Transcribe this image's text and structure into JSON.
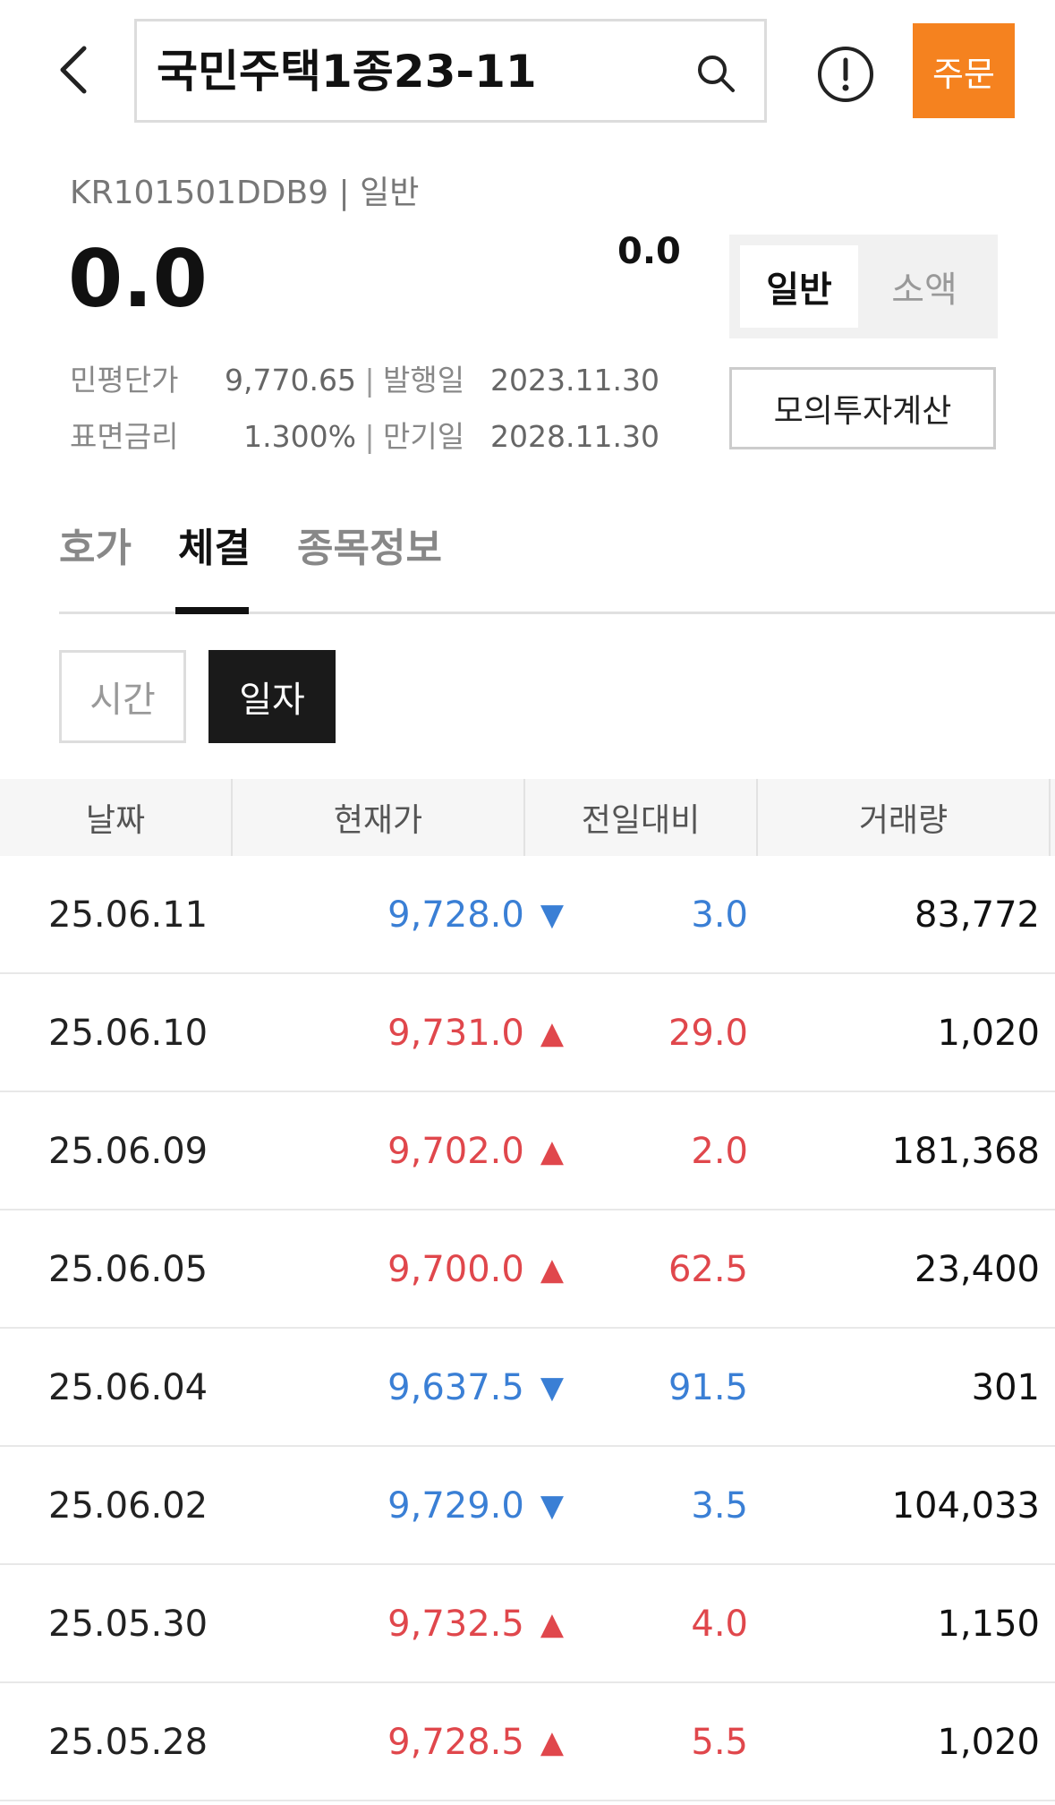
{
  "header": {
    "search_text": "국민주택1종23-11",
    "order_label": "주문"
  },
  "summary": {
    "code_line": "KR101501DDB9 | 일반",
    "price": "0.0",
    "change": "0.0",
    "segment": {
      "active": "일반",
      "inactive": "소액"
    },
    "calc_label": "모의투자계산",
    "info": [
      {
        "label1": "민평단가",
        "value1": "9,770.65",
        "label2": "발행일",
        "value2": "2023.11.30"
      },
      {
        "label1": "표면금리",
        "value1": "1.300%",
        "label2": "만기일",
        "value2": "2028.11.30"
      }
    ]
  },
  "tabs": [
    {
      "label": "호가"
    },
    {
      "label": "체결"
    },
    {
      "label": "종목정보"
    }
  ],
  "toggle": {
    "off": "시간",
    "on": "일자"
  },
  "table": {
    "headers": [
      "날짜",
      "현재가",
      "전일대비",
      "거래량"
    ],
    "rows": [
      {
        "date": "25.06.11",
        "price": "9,728.0",
        "dir": "down",
        "change": "3.0",
        "volume": "83,772"
      },
      {
        "date": "25.06.10",
        "price": "9,731.0",
        "dir": "up",
        "change": "29.0",
        "volume": "1,020"
      },
      {
        "date": "25.06.09",
        "price": "9,702.0",
        "dir": "up",
        "change": "2.0",
        "volume": "181,368"
      },
      {
        "date": "25.06.05",
        "price": "9,700.0",
        "dir": "up",
        "change": "62.5",
        "volume": "23,400"
      },
      {
        "date": "25.06.04",
        "price": "9,637.5",
        "dir": "down",
        "change": "91.5",
        "volume": "301"
      },
      {
        "date": "25.06.02",
        "price": "9,729.0",
        "dir": "down",
        "change": "3.5",
        "volume": "104,033"
      },
      {
        "date": "25.05.30",
        "price": "9,732.5",
        "dir": "up",
        "change": "4.0",
        "volume": "1,150"
      },
      {
        "date": "25.05.28",
        "price": "9,728.5",
        "dir": "up",
        "change": "5.5",
        "volume": "1,020"
      }
    ]
  },
  "colors": {
    "up": "#e0474c",
    "down": "#3a7fd5",
    "accent": "#f5821f"
  },
  "icons": {
    "back": "chevron-left-icon",
    "search": "search-icon",
    "info": "info-icon",
    "up": "triangle-up-icon",
    "down": "triangle-down-icon"
  }
}
